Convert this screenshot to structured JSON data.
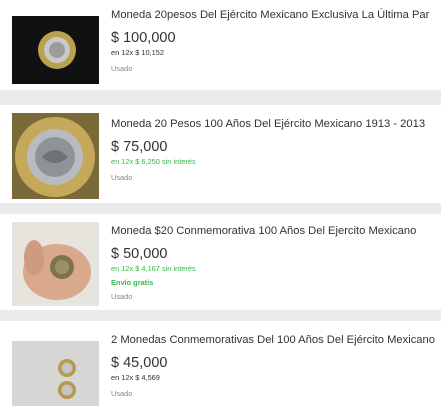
{
  "listings": [
    {
      "title": "Moneda 20pesos Del Ejército Mexicano Exclusiva La Última Par",
      "price": "$ 100,000",
      "installments": "en 12x $ 10,152",
      "shipping": "",
      "condition": "Usado"
    },
    {
      "title": "Moneda 20 Pesos 100 Años Del Ejército Mexicano 1913 - 2013",
      "price": "$ 75,000",
      "installments": "en 12x $ 6,250 sin interés",
      "shipping": "",
      "condition": "Usado"
    },
    {
      "title": "Moneda $20 Conmemorativa 100 Años Del Ejercito Mexicano",
      "price": "$ 50,000",
      "installments": "en 12x $ 4,167 sin interés",
      "shipping": "Envío gratis",
      "condition": "Usado"
    },
    {
      "title": "2 Monedas Conmemorativas Del 100 Años Del Ejército Mexicano",
      "price": "$ 45,000",
      "installments": "en 12x $ 4,569",
      "shipping": "",
      "condition": "Usado"
    }
  ],
  "colors": {
    "background": "#ebebeb",
    "card": "#ffffff",
    "text": "#333333",
    "green": "#39b54a",
    "muted": "#888888"
  },
  "icons": [
    "coin-photo",
    "coin-closeup-photo",
    "coin-in-hand-photo",
    "two-coins-photo"
  ]
}
